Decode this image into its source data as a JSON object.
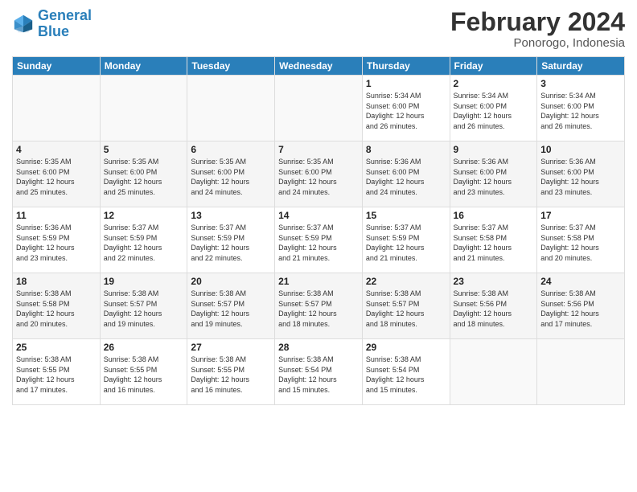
{
  "logo": {
    "line1": "General",
    "line2": "Blue"
  },
  "title": "February 2024",
  "location": "Ponorogo, Indonesia",
  "days_header": [
    "Sunday",
    "Monday",
    "Tuesday",
    "Wednesday",
    "Thursday",
    "Friday",
    "Saturday"
  ],
  "weeks": [
    [
      {
        "num": "",
        "info": ""
      },
      {
        "num": "",
        "info": ""
      },
      {
        "num": "",
        "info": ""
      },
      {
        "num": "",
        "info": ""
      },
      {
        "num": "1",
        "info": "Sunrise: 5:34 AM\nSunset: 6:00 PM\nDaylight: 12 hours\nand 26 minutes."
      },
      {
        "num": "2",
        "info": "Sunrise: 5:34 AM\nSunset: 6:00 PM\nDaylight: 12 hours\nand 26 minutes."
      },
      {
        "num": "3",
        "info": "Sunrise: 5:34 AM\nSunset: 6:00 PM\nDaylight: 12 hours\nand 26 minutes."
      }
    ],
    [
      {
        "num": "4",
        "info": "Sunrise: 5:35 AM\nSunset: 6:00 PM\nDaylight: 12 hours\nand 25 minutes."
      },
      {
        "num": "5",
        "info": "Sunrise: 5:35 AM\nSunset: 6:00 PM\nDaylight: 12 hours\nand 25 minutes."
      },
      {
        "num": "6",
        "info": "Sunrise: 5:35 AM\nSunset: 6:00 PM\nDaylight: 12 hours\nand 24 minutes."
      },
      {
        "num": "7",
        "info": "Sunrise: 5:35 AM\nSunset: 6:00 PM\nDaylight: 12 hours\nand 24 minutes."
      },
      {
        "num": "8",
        "info": "Sunrise: 5:36 AM\nSunset: 6:00 PM\nDaylight: 12 hours\nand 24 minutes."
      },
      {
        "num": "9",
        "info": "Sunrise: 5:36 AM\nSunset: 6:00 PM\nDaylight: 12 hours\nand 23 minutes."
      },
      {
        "num": "10",
        "info": "Sunrise: 5:36 AM\nSunset: 6:00 PM\nDaylight: 12 hours\nand 23 minutes."
      }
    ],
    [
      {
        "num": "11",
        "info": "Sunrise: 5:36 AM\nSunset: 5:59 PM\nDaylight: 12 hours\nand 23 minutes."
      },
      {
        "num": "12",
        "info": "Sunrise: 5:37 AM\nSunset: 5:59 PM\nDaylight: 12 hours\nand 22 minutes."
      },
      {
        "num": "13",
        "info": "Sunrise: 5:37 AM\nSunset: 5:59 PM\nDaylight: 12 hours\nand 22 minutes."
      },
      {
        "num": "14",
        "info": "Sunrise: 5:37 AM\nSunset: 5:59 PM\nDaylight: 12 hours\nand 21 minutes."
      },
      {
        "num": "15",
        "info": "Sunrise: 5:37 AM\nSunset: 5:59 PM\nDaylight: 12 hours\nand 21 minutes."
      },
      {
        "num": "16",
        "info": "Sunrise: 5:37 AM\nSunset: 5:58 PM\nDaylight: 12 hours\nand 21 minutes."
      },
      {
        "num": "17",
        "info": "Sunrise: 5:37 AM\nSunset: 5:58 PM\nDaylight: 12 hours\nand 20 minutes."
      }
    ],
    [
      {
        "num": "18",
        "info": "Sunrise: 5:38 AM\nSunset: 5:58 PM\nDaylight: 12 hours\nand 20 minutes."
      },
      {
        "num": "19",
        "info": "Sunrise: 5:38 AM\nSunset: 5:57 PM\nDaylight: 12 hours\nand 19 minutes."
      },
      {
        "num": "20",
        "info": "Sunrise: 5:38 AM\nSunset: 5:57 PM\nDaylight: 12 hours\nand 19 minutes."
      },
      {
        "num": "21",
        "info": "Sunrise: 5:38 AM\nSunset: 5:57 PM\nDaylight: 12 hours\nand 18 minutes."
      },
      {
        "num": "22",
        "info": "Sunrise: 5:38 AM\nSunset: 5:57 PM\nDaylight: 12 hours\nand 18 minutes."
      },
      {
        "num": "23",
        "info": "Sunrise: 5:38 AM\nSunset: 5:56 PM\nDaylight: 12 hours\nand 18 minutes."
      },
      {
        "num": "24",
        "info": "Sunrise: 5:38 AM\nSunset: 5:56 PM\nDaylight: 12 hours\nand 17 minutes."
      }
    ],
    [
      {
        "num": "25",
        "info": "Sunrise: 5:38 AM\nSunset: 5:55 PM\nDaylight: 12 hours\nand 17 minutes."
      },
      {
        "num": "26",
        "info": "Sunrise: 5:38 AM\nSunset: 5:55 PM\nDaylight: 12 hours\nand 16 minutes."
      },
      {
        "num": "27",
        "info": "Sunrise: 5:38 AM\nSunset: 5:55 PM\nDaylight: 12 hours\nand 16 minutes."
      },
      {
        "num": "28",
        "info": "Sunrise: 5:38 AM\nSunset: 5:54 PM\nDaylight: 12 hours\nand 15 minutes."
      },
      {
        "num": "29",
        "info": "Sunrise: 5:38 AM\nSunset: 5:54 PM\nDaylight: 12 hours\nand 15 minutes."
      },
      {
        "num": "",
        "info": ""
      },
      {
        "num": "",
        "info": ""
      }
    ]
  ]
}
